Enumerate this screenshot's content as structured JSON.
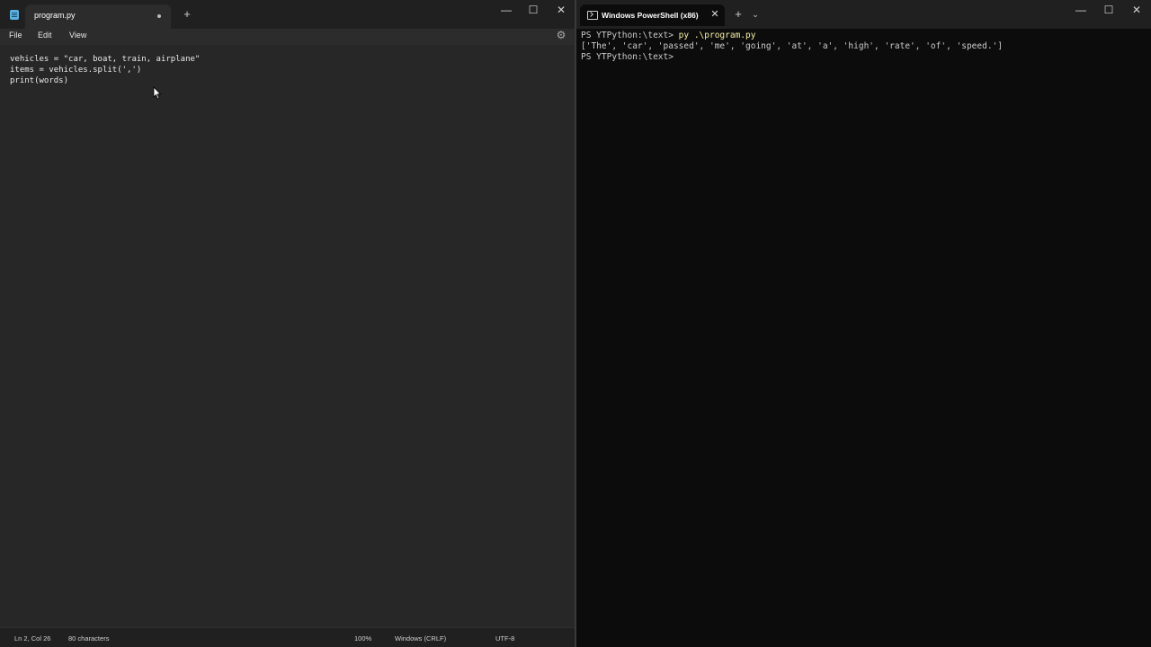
{
  "notepad": {
    "tab_title": "program.py",
    "menu": [
      "File",
      "Edit",
      "View"
    ],
    "code_lines": [
      "vehicles = \"car, boat, train, airplane\"",
      "items = vehicles.split(',')",
      "print(words)"
    ],
    "status": {
      "position": "Ln 2, Col 26",
      "characters": "80 characters",
      "zoom": "100%",
      "line_ending": "Windows (CRLF)",
      "encoding": "UTF-8"
    },
    "icons": [
      "notepad-icon",
      "unsaved-dot-icon",
      "plus-icon",
      "minimize-icon",
      "maximize-icon",
      "close-icon",
      "gear-icon",
      "mouse-pointer-icon"
    ]
  },
  "terminal": {
    "tab_title": "Windows PowerShell (x86)",
    "lines": [
      {
        "prompt": "PS YTPython:\\text> ",
        "command": "py .\\program.py"
      },
      {
        "output": "['The', 'car', 'passed', 'me', 'going', 'at', 'a', 'high', 'rate', 'of', 'speed.']"
      },
      {
        "prompt": "PS YTPython:\\text>",
        "command": ""
      }
    ],
    "icons": [
      "terminal-icon",
      "close-icon",
      "plus-icon",
      "chevron-down-icon",
      "minimize-icon",
      "maximize-icon"
    ]
  },
  "colors": {
    "editor_bg": "#272727",
    "terminal_bg": "#0c0c0c",
    "command_text": "#f9f1a5",
    "terminal_text": "#cccccc"
  }
}
